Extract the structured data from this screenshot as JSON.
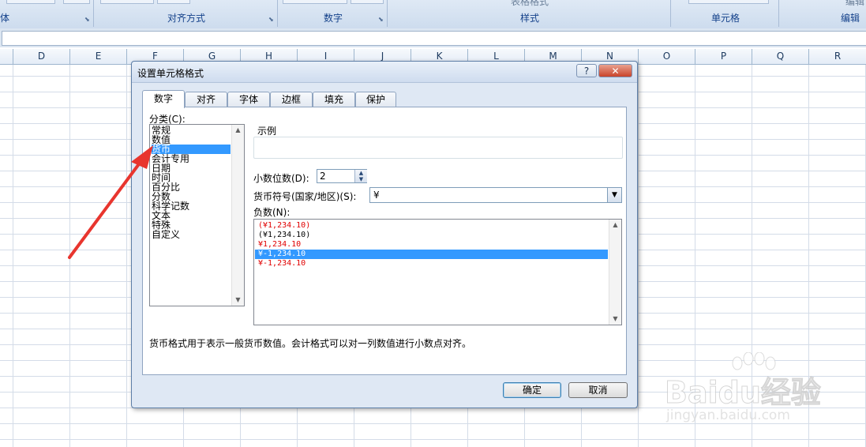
{
  "ribbon": {
    "groups": [
      {
        "label": "体"
      },
      {
        "label": "对齐方式"
      },
      {
        "label": "数字"
      },
      {
        "label": "样式",
        "top_text": "表格格式"
      },
      {
        "label": "单元格"
      },
      {
        "label": "编辑",
        "top_text": "编辑"
      }
    ]
  },
  "columns": [
    "D",
    "E",
    "F",
    "G",
    "H",
    "I",
    "J",
    "K",
    "L",
    "M",
    "N",
    "O",
    "P",
    "Q",
    "R"
  ],
  "dialog": {
    "title": "设置单元格格式",
    "help_label": "?",
    "close_label": "✕",
    "tabs": [
      "数字",
      "对齐",
      "字体",
      "边框",
      "填充",
      "保护"
    ],
    "active_tab": "数字",
    "category_label": "分类(C):",
    "categories": [
      "常规",
      "数值",
      "货币",
      "会计专用",
      "日期",
      "时间",
      "百分比",
      "分数",
      "科学记数",
      "文本",
      "特殊",
      "自定义"
    ],
    "selected_category": "货币",
    "sample_label": "示例",
    "sample_value": "",
    "decimal_label": "小数位数(D):",
    "decimal_value": "2",
    "currency_label": "货币符号(国家/地区)(S):",
    "currency_value": "¥",
    "negative_label": "负数(N):",
    "negative_formats": [
      {
        "text": "(¥1,234.10)",
        "color": "#e00000"
      },
      {
        "text": "(¥1,234.10)",
        "color": "#000000"
      },
      {
        "text": "¥1,234.10",
        "color": "#e00000"
      },
      {
        "text": "¥-1,234.10",
        "color": "#ffffff",
        "selected": true
      },
      {
        "text": "¥-1,234.10",
        "color": "#e00000"
      }
    ],
    "description": "货币格式用于表示一般货币数值。会计格式可以对一列数值进行小数点对齐。",
    "ok_label": "确定",
    "cancel_label": "取消"
  },
  "watermark": {
    "brand": "Baidu经验",
    "url": "jingyan.baidu.com"
  },
  "colors": {
    "selection": "#3399ff",
    "annotation_arrow": "#e8352e",
    "negative_red": "#e00000"
  }
}
